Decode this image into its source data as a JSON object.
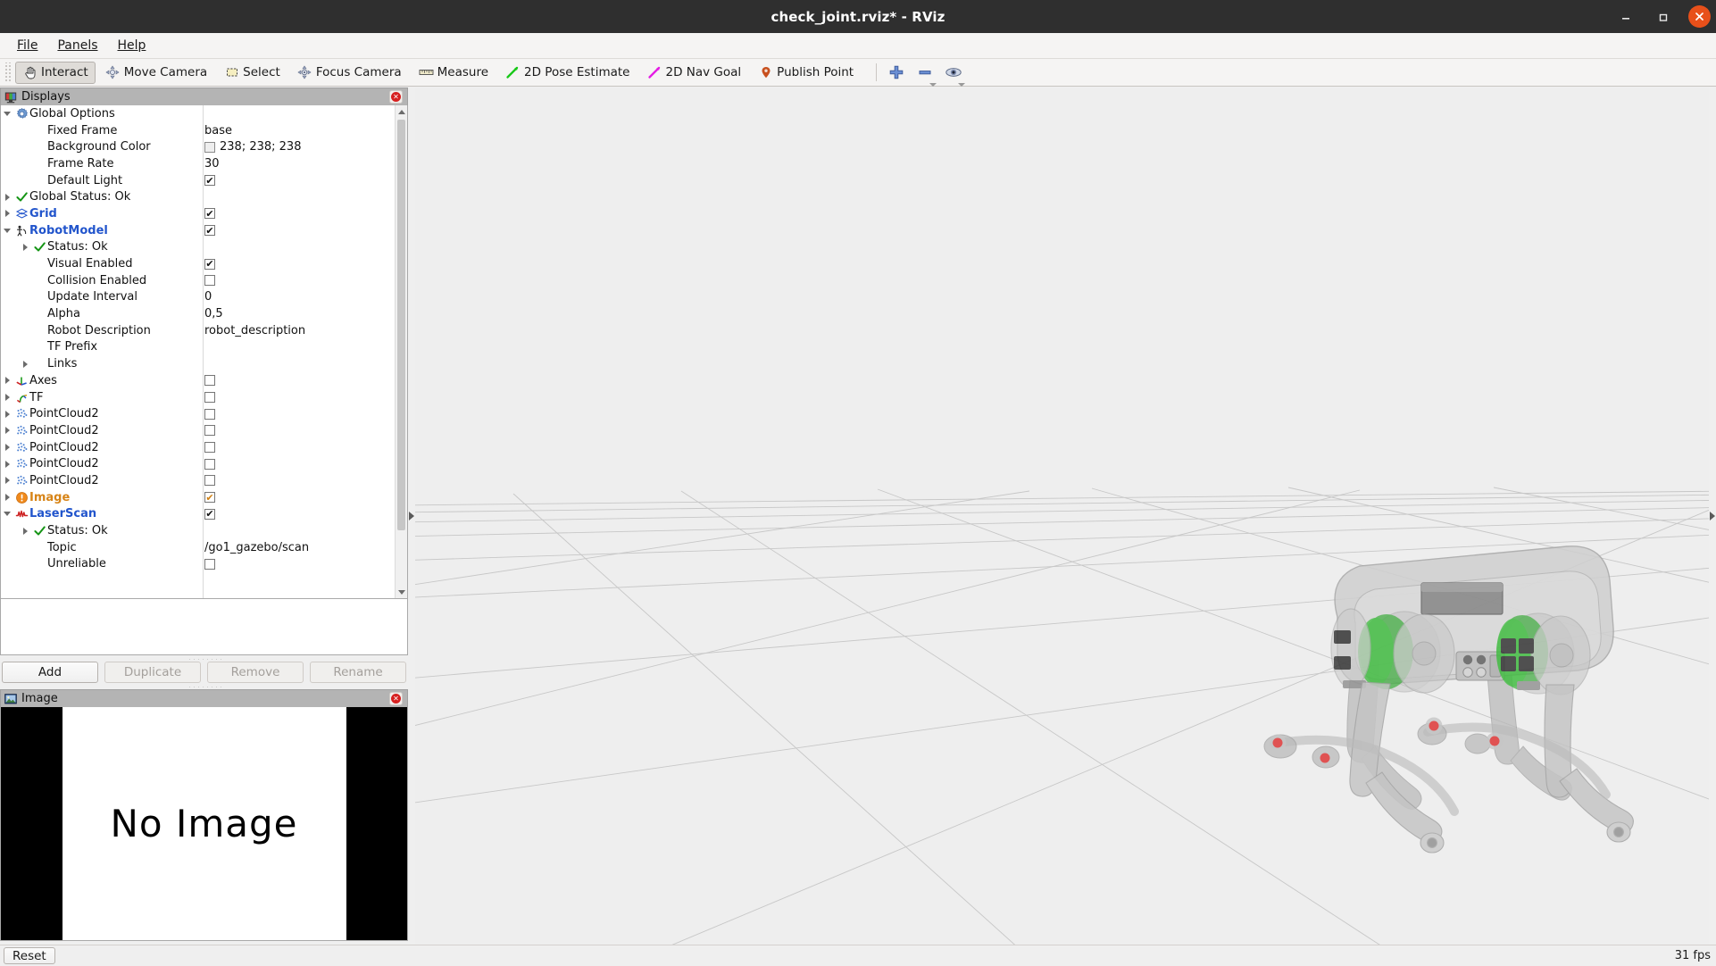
{
  "window": {
    "title": "check_joint.rviz* - RViz",
    "minimize_label": "—",
    "maximize_label": "❐",
    "close_label": "✕"
  },
  "menubar": {
    "items": [
      {
        "label": "File",
        "mnemonic": "F"
      },
      {
        "label": "Panels",
        "mnemonic": "P"
      },
      {
        "label": "Help",
        "mnemonic": "H"
      }
    ]
  },
  "toolbar": {
    "tools": [
      {
        "label": "Interact",
        "icon": "hand-cursor-icon",
        "active": true
      },
      {
        "label": "Move Camera",
        "icon": "move-camera-icon",
        "active": false
      },
      {
        "label": "Select",
        "icon": "select-rect-icon",
        "active": false
      },
      {
        "label": "Focus Camera",
        "icon": "focus-camera-icon",
        "active": false
      },
      {
        "label": "Measure",
        "icon": "ruler-icon",
        "active": false
      },
      {
        "label": "2D Pose Estimate",
        "icon": "green-arrow-icon",
        "active": false
      },
      {
        "label": "2D Nav Goal",
        "icon": "magenta-arrow-icon",
        "active": false
      },
      {
        "label": "Publish Point",
        "icon": "map-pin-icon",
        "active": false
      }
    ],
    "extra_buttons": [
      {
        "name": "add-tool-button",
        "icon": "plus-icon"
      },
      {
        "name": "remove-tool-button",
        "icon": "minus-icon"
      },
      {
        "name": "tool-visibility-button",
        "icon": "eye-icon"
      }
    ]
  },
  "displays_panel": {
    "title": "Displays",
    "icon": "displays-panel-icon",
    "close_icon": "close-icon",
    "rows": [
      {
        "indent": 0,
        "expander": "down",
        "icon": "gear-icon",
        "label": "Global Options",
        "style": "plain",
        "value_kind": "none"
      },
      {
        "indent": 1,
        "expander": "none",
        "icon": "none",
        "label": "Fixed Frame",
        "style": "plain",
        "value_kind": "text",
        "value": "base"
      },
      {
        "indent": 1,
        "expander": "none",
        "icon": "none",
        "label": "Background Color",
        "style": "plain",
        "value_kind": "color",
        "value": "238; 238; 238",
        "color": "#eeeeee"
      },
      {
        "indent": 1,
        "expander": "none",
        "icon": "none",
        "label": "Frame Rate",
        "style": "plain",
        "value_kind": "text",
        "value": "30"
      },
      {
        "indent": 1,
        "expander": "none",
        "icon": "none",
        "label": "Default Light",
        "style": "plain",
        "value_kind": "checkbox",
        "checked": true
      },
      {
        "indent": 0,
        "expander": "right",
        "icon": "status-ok-icon",
        "label": "Global Status: Ok",
        "style": "plain",
        "value_kind": "none"
      },
      {
        "indent": 0,
        "expander": "right",
        "icon": "grid-icon",
        "label": "Grid",
        "style": "blue",
        "value_kind": "checkbox",
        "checked": true
      },
      {
        "indent": 0,
        "expander": "down",
        "icon": "robotmodel-icon",
        "label": "RobotModel",
        "style": "blue",
        "value_kind": "checkbox",
        "checked": true
      },
      {
        "indent": 1,
        "expander": "right",
        "icon": "status-ok-icon",
        "label": "Status: Ok",
        "style": "plain",
        "value_kind": "none"
      },
      {
        "indent": 1,
        "expander": "none",
        "icon": "none",
        "label": "Visual Enabled",
        "style": "plain",
        "value_kind": "checkbox",
        "checked": true
      },
      {
        "indent": 1,
        "expander": "none",
        "icon": "none",
        "label": "Collision Enabled",
        "style": "plain",
        "value_kind": "checkbox",
        "checked": false
      },
      {
        "indent": 1,
        "expander": "none",
        "icon": "none",
        "label": "Update Interval",
        "style": "plain",
        "value_kind": "text",
        "value": "0"
      },
      {
        "indent": 1,
        "expander": "none",
        "icon": "none",
        "label": "Alpha",
        "style": "plain",
        "value_kind": "text",
        "value": "0,5"
      },
      {
        "indent": 1,
        "expander": "none",
        "icon": "none",
        "label": "Robot Description",
        "style": "plain",
        "value_kind": "text",
        "value": "robot_description"
      },
      {
        "indent": 1,
        "expander": "none",
        "icon": "none",
        "label": "TF Prefix",
        "style": "plain",
        "value_kind": "none"
      },
      {
        "indent": 1,
        "expander": "right",
        "icon": "none",
        "label": "Links",
        "style": "plain",
        "value_kind": "none"
      },
      {
        "indent": 0,
        "expander": "right",
        "icon": "axes-icon",
        "label": "Axes",
        "style": "plain",
        "value_kind": "checkbox",
        "checked": false
      },
      {
        "indent": 0,
        "expander": "right",
        "icon": "tf-icon",
        "label": "TF",
        "style": "plain",
        "value_kind": "checkbox",
        "checked": false
      },
      {
        "indent": 0,
        "expander": "right",
        "icon": "pointcloud-icon",
        "label": "PointCloud2",
        "style": "plain",
        "value_kind": "checkbox",
        "checked": false
      },
      {
        "indent": 0,
        "expander": "right",
        "icon": "pointcloud-icon",
        "label": "PointCloud2",
        "style": "plain",
        "value_kind": "checkbox",
        "checked": false
      },
      {
        "indent": 0,
        "expander": "right",
        "icon": "pointcloud-icon",
        "label": "PointCloud2",
        "style": "plain",
        "value_kind": "checkbox",
        "checked": false
      },
      {
        "indent": 0,
        "expander": "right",
        "icon": "pointcloud-icon",
        "label": "PointCloud2",
        "style": "plain",
        "value_kind": "checkbox",
        "checked": false
      },
      {
        "indent": 0,
        "expander": "right",
        "icon": "pointcloud-icon",
        "label": "PointCloud2",
        "style": "plain",
        "value_kind": "checkbox",
        "checked": false
      },
      {
        "indent": 0,
        "expander": "right",
        "icon": "warning-icon",
        "label": "Image",
        "style": "orange",
        "value_kind": "checkbox",
        "checked": true,
        "check_color": "orange"
      },
      {
        "indent": 0,
        "expander": "down",
        "icon": "laserscan-icon",
        "label": "LaserScan",
        "style": "blue",
        "value_kind": "checkbox",
        "checked": true
      },
      {
        "indent": 1,
        "expander": "right",
        "icon": "status-ok-icon",
        "label": "Status: Ok",
        "style": "plain",
        "value_kind": "none"
      },
      {
        "indent": 1,
        "expander": "none",
        "icon": "none",
        "label": "Topic",
        "style": "plain",
        "value_kind": "text",
        "value": "/go1_gazebo/scan"
      },
      {
        "indent": 1,
        "expander": "none",
        "icon": "none",
        "label": "Unreliable",
        "style": "plain",
        "value_kind": "checkbox",
        "checked": false
      }
    ],
    "buttons": [
      {
        "label": "Add",
        "enabled": true
      },
      {
        "label": "Duplicate",
        "enabled": false
      },
      {
        "label": "Remove",
        "enabled": false
      },
      {
        "label": "Rename",
        "enabled": false
      }
    ]
  },
  "image_panel": {
    "title": "Image",
    "icon": "image-panel-icon",
    "close_icon": "close-icon",
    "placeholder_text": "No Image"
  },
  "statusbar": {
    "reset_label": "Reset",
    "fps": "31 fps"
  },
  "viewport": {
    "background_color": "#eeeeee",
    "grid_line_color": "#c9c9c9",
    "robot_name": "Unitree Go1 quadruped",
    "robot_body_color": "#b9b9b9",
    "robot_joint_color": "#3ab03a",
    "robot_foot_marker_color": "#e04040",
    "collapse_left_icon": "chevron-left-icon",
    "collapse_right_icon": "chevron-right-icon"
  }
}
